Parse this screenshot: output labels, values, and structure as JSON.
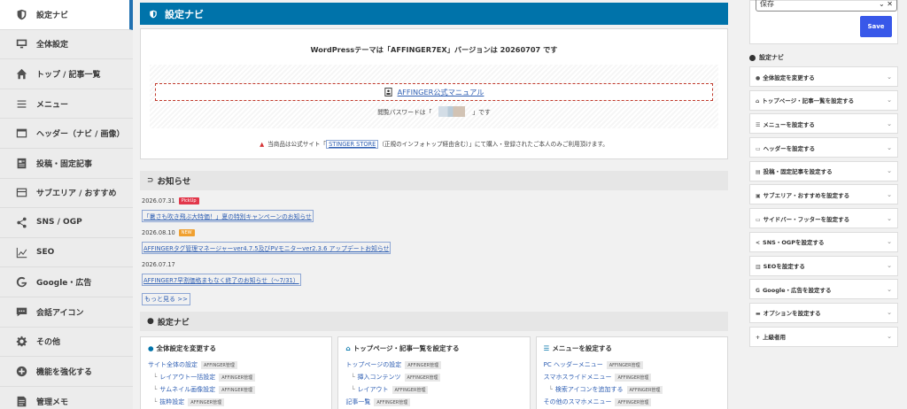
{
  "sidebar": {
    "items": [
      {
        "label": "設定ナビ",
        "icon": "shield-icon",
        "active": true
      },
      {
        "label": "全体設定",
        "icon": "monitor-icon"
      },
      {
        "label": "トップ / 記事一覧",
        "icon": "home-icon"
      },
      {
        "label": "メニュー",
        "icon": "menu-icon"
      },
      {
        "label": "ヘッダー（ナビ / 画像）",
        "icon": "header-icon"
      },
      {
        "label": "投稿・固定記事",
        "icon": "post-icon"
      },
      {
        "label": "サブエリア / おすすめ",
        "icon": "subarea-icon"
      },
      {
        "label": "SNS / OGP",
        "icon": "share-icon"
      },
      {
        "label": "SEO",
        "icon": "chart-icon"
      },
      {
        "label": "Google・広告",
        "icon": "google-icon"
      },
      {
        "label": "会話アイコン",
        "icon": "chat-icon"
      },
      {
        "label": "その他",
        "icon": "gear-icon"
      },
      {
        "label": "機能を強化する",
        "icon": "plus-circle-icon"
      },
      {
        "label": "管理メモ",
        "icon": "memo-icon"
      }
    ]
  },
  "main": {
    "title": "設定ナビ",
    "version_text": "WordPressテーマは「AFFINGER7EX」バージョンは 20260707 です",
    "manual_link": "AFFINGER公式マニュアル",
    "password_prefix": "閲覧パスワードは「",
    "password_suffix": "」です",
    "notice_prefix": "当商品は公式サイト「",
    "notice_store": "STINGER STORE",
    "notice_suffix": "（正規のインフォトップ経由含む）」にて購入・登録されたご本人のみご利用頂けます。",
    "news_heading": "お知らせ",
    "news": [
      {
        "date": "2026.07.31",
        "badge": "PickUp",
        "badge_color": "#e2374a",
        "title": "「暑さも吹き飛ぶ大特価！」夏の特別キャンペーンのお知らせ"
      },
      {
        "date": "2026.08.10",
        "badge": "NEW",
        "badge_color": "#f0a030",
        "title": "AFFINGERタグ管理マネージャーver4.7.5及びPVモニターver2.3.6 アップデートお知らせ"
      },
      {
        "date": "2026.07.17",
        "badge": "",
        "badge_color": "",
        "title": "AFFINGER7早割価格まもなく終了のお知らせ（〜7/31）"
      }
    ],
    "more_link": "もっと見る >>",
    "nav_heading": "設定ナビ",
    "cards": [
      {
        "title": "全体設定を変更する",
        "rows": [
          {
            "text": "サイト全体の設定",
            "tag": "AFFINGER管理",
            "sub": false
          },
          {
            "text": "レイアウト一括設定",
            "tag": "AFFINGER管理",
            "sub": true
          },
          {
            "text": "サムネイル画像設定",
            "tag": "AFFINGER管理",
            "sub": true
          },
          {
            "text": "抜粋設定",
            "tag": "AFFINGER管理",
            "sub": true
          }
        ]
      },
      {
        "title": "トップページ・記事一覧を設定する",
        "rows": [
          {
            "text": "トップページの設定",
            "tag": "AFFINGER管理",
            "sub": false
          },
          {
            "text": "挿入コンテンツ",
            "tag": "AFFINGER管理",
            "sub": true
          },
          {
            "text": "レイアウト",
            "tag": "AFFINGER管理",
            "sub": true
          },
          {
            "text": "記事一覧",
            "tag": "AFFINGER管理",
            "sub": false
          }
        ]
      },
      {
        "title": "メニューを設定する",
        "rows": [
          {
            "text": "PC ヘッダーメニュー",
            "tag": "AFFINGER管理",
            "sub": false
          },
          {
            "text": "スマホスライドメニュー",
            "tag": "AFFINGER管理",
            "sub": false
          },
          {
            "text": "検索アイコンを追加する",
            "tag": "AFFINGER管理",
            "sub": true
          },
          {
            "text": "その他のスマホメニュー",
            "tag": "AFFINGER管理",
            "sub": false
          }
        ]
      }
    ]
  },
  "right": {
    "select_value": "保存",
    "save_label": "Save",
    "nav_heading": "設定ナビ",
    "items": [
      {
        "label": "全体設定を変更する",
        "icon": "palette-icon"
      },
      {
        "label": "トップページ・記事一覧を設定する",
        "icon": "home-icon"
      },
      {
        "label": "メニューを設定する",
        "icon": "menu-icon"
      },
      {
        "label": "ヘッダーを設定する",
        "icon": "header-icon"
      },
      {
        "label": "投稿・固定記事を設定する",
        "icon": "post-icon"
      },
      {
        "label": "サブエリア・おすすめを設定する",
        "icon": "image-icon"
      },
      {
        "label": "サイドバー・フッターを設定する",
        "icon": "sidebar-icon"
      },
      {
        "label": "SNS・OGPを設定する",
        "icon": "share-icon"
      },
      {
        "label": "SEOを設定する",
        "icon": "chart-icon"
      },
      {
        "label": "Google・広告を設定する",
        "icon": "google-icon"
      },
      {
        "label": "オプションを設定する",
        "icon": "chat-icon"
      },
      {
        "label": "上級者用",
        "icon": "plus-icon"
      }
    ]
  },
  "colors": {
    "accent": "#0073aa",
    "save": "#3858e9",
    "link": "#2f5fb3",
    "warn": "#d63638"
  }
}
